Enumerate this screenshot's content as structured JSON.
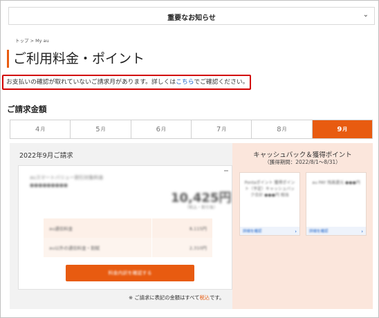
{
  "notice_bar": {
    "label": "重要なお知らせ",
    "chevron_icon": "chevron-down-icon"
  },
  "breadcrumb": "トップ > My au",
  "page_title": "ご利用料金・ポイント",
  "alert": {
    "before": "お支払いの確認が取れていないご請求月があります。詳しくは",
    "link": "こちら",
    "after": "でご確認ください。"
  },
  "section_title": "ご請求金額",
  "tabs": [
    {
      "num": "4",
      "unit": "月",
      "active": false
    },
    {
      "num": "5",
      "unit": "月",
      "active": false
    },
    {
      "num": "6",
      "unit": "月",
      "active": false
    },
    {
      "num": "7",
      "unit": "月",
      "active": false
    },
    {
      "num": "8",
      "unit": "月",
      "active": false
    },
    {
      "num": "9",
      "unit": "月",
      "active": true
    }
  ],
  "bill": {
    "heading": "2022年9月ご請求",
    "card_line1": "auスマートバリュー割引対象料金",
    "card_line2": "●●●●●●●●●",
    "amount": "10,425円",
    "amount_sub": "（税込・割引後）",
    "rows": [
      {
        "label": "au通信料金",
        "value": "8,115円"
      },
      {
        "label": "au以外の通信料金・割賦",
        "value": "2,310円"
      }
    ],
    "button_label": "料金内訳を確認する",
    "note_before": "※ ご請求に表記の金額はすべて",
    "note_link": "税込",
    "note_after": "です。"
  },
  "cashback": {
    "title": "キャッシュバック＆獲得ポイント",
    "subtitle": "（獲得期間：2022/8/1～8/31）",
    "cards": [
      {
        "text": "Pontaポイント 獲得ポイント（予定）キャッシュバック合計 ●●●円 相当",
        "link": "詳細を確認"
      },
      {
        "text": "au PAY 残高還元 ●●●円",
        "link": "詳細を確認"
      }
    ]
  },
  "colors": {
    "accent": "#e85b10",
    "alert_border": "#d20000",
    "link": "#1a62c9",
    "panel_bg": "#f2f2f2",
    "cashback_bg": "#fbe6dc"
  }
}
